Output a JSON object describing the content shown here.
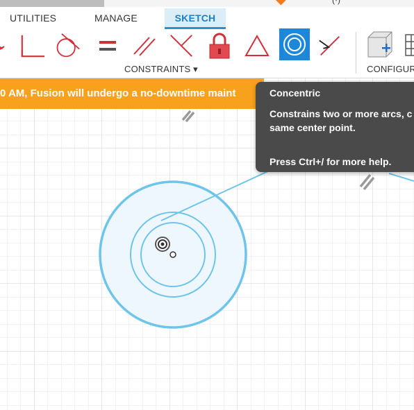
{
  "toolbar": {
    "tabs": [
      {
        "label": "UTILITIES"
      },
      {
        "label": "MANAGE"
      },
      {
        "label": "SKETCH"
      }
    ],
    "active_tab": "SKETCH",
    "title_fragment": "(·)",
    "groups": {
      "constraints": "CONSTRAINTS ▾",
      "configure": "CONFIGUR"
    },
    "tools": [
      {
        "name": "perpendicular-icon"
      },
      {
        "name": "tangent-icon"
      },
      {
        "name": "equal-icon"
      },
      {
        "name": "parallel-icon"
      },
      {
        "name": "midpoint-icon"
      },
      {
        "name": "fix-lock-icon"
      },
      {
        "name": "symmetry-icon"
      },
      {
        "name": "concentric-icon",
        "active": true
      },
      {
        "name": "collinear-icon"
      },
      {
        "name": "configure-icon"
      }
    ]
  },
  "notification": {
    "text": "0 AM, Fusion will undergo a no-downtime maint"
  },
  "tooltip": {
    "title": "Concentric",
    "description_line1": "Constrains two or more arcs, c",
    "description_line2": "same center point.",
    "help": "Press Ctrl+/ for more help."
  },
  "colors": {
    "accent": "#1e88d8",
    "constraint_red": "#d0303a",
    "banner": "#f7a11c",
    "sketch_blue": "#6ec4ea"
  }
}
